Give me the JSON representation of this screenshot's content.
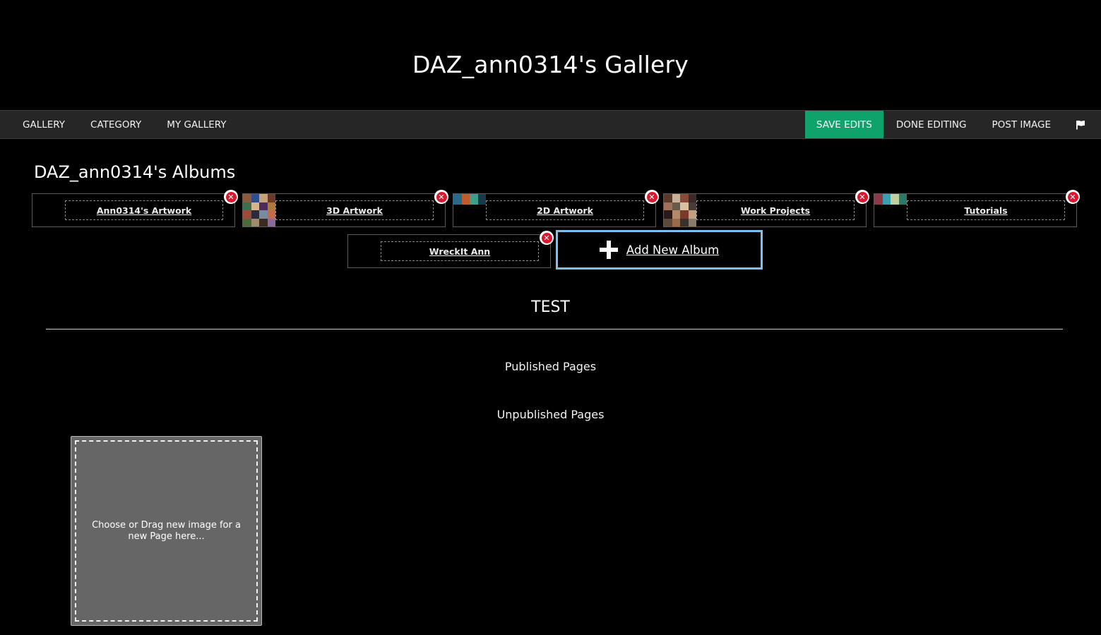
{
  "site": {
    "title": "DAZ_ann0314's Gallery"
  },
  "nav": {
    "left": [
      "GALLERY",
      "CATEGORY",
      "MY GALLERY"
    ],
    "right": {
      "save": "SAVE EDITS",
      "done": "DONE EDITING",
      "post": "POST IMAGE",
      "flag_icon": "flag-icon"
    }
  },
  "albums": {
    "title": "DAZ_ann0314's Albums",
    "items": [
      {
        "name": "Ann0314's Artwork"
      },
      {
        "name": "3D Artwork"
      },
      {
        "name": "2D Artwork"
      },
      {
        "name": "Work Projects"
      },
      {
        "name": "Tutorials"
      },
      {
        "name": "WreckIt Ann"
      }
    ],
    "add_label": "Add New Album",
    "delete_icon": "delete-icon"
  },
  "section": {
    "title": "TEST",
    "published_label": "Published Pages",
    "unpublished_label": "Unpublished Pages",
    "dropzone_text": "Choose or Drag new image for a new Page here..."
  },
  "colors": {
    "background": "#000000",
    "navbar": "#262626",
    "save_button": "#0fa36b",
    "add_album_border": "#7ec0ee",
    "delete_badge": "#d9182f",
    "dropzone": "#666666"
  }
}
